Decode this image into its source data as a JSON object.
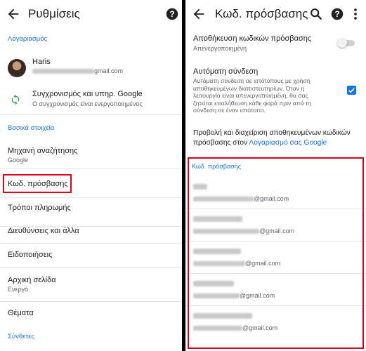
{
  "left": {
    "title": "Ρυθμίσεις",
    "section_account": "Λογαριασμός",
    "account": {
      "name": "Haris",
      "email_domain": "gmail.com"
    },
    "sync": {
      "label": "Συγχρονισμός και υπηρ. Google",
      "status": "Ο συγχρονισμός είναι ενεργοποιημένος"
    },
    "section_basic": "Βασικά στοιχεία",
    "items": [
      {
        "label": "Μηχανή αναζήτησης",
        "value": "Google"
      },
      {
        "label": "Κωδ. πρόσβασης"
      },
      {
        "label": "Τρόποι πληρωμής"
      },
      {
        "label": "Διευθύνσεις και άλλα"
      },
      {
        "label": "Ειδοποιήσεις"
      },
      {
        "label": "Αρχική σελίδα",
        "value": "Ενεργό"
      },
      {
        "label": "Θέματα"
      }
    ],
    "section_advanced": "Σύνθετες"
  },
  "right": {
    "title": "Κωδ. πρόσβασης",
    "save_passwords": {
      "label": "Αποθήκευση κωδικών πρόσβασης",
      "status": "Απενεργοποιημένη",
      "enabled": false
    },
    "auto_signin": {
      "label": "Αυτόματη σύνδεση",
      "description": [
        "Αυτόματη σύνδεση σε ιστότοπους με χρήση",
        "αποθηκευμένων διαπιστευτηρίων. Όταν η",
        "λειτουργία είναι απενεργοποιημένη, θα σας",
        "ζητείται επαλήθευση κάθε φορά πριν από τη",
        "σύνδεση σε έναν ιστότοπο."
      ],
      "checked": true
    },
    "manage": {
      "line1": "Προβολή και διαχείριση αποθηκευμένων κωδικών",
      "line2_prefix": "πρόσβασης στον ",
      "line2_link": "Λογαριασμό σας Google"
    },
    "section_passwords": "Κωδ. πρόσβασης",
    "passwords": [
      {
        "email_domain": "@gmail.com"
      },
      {
        "email_domain": "@gmail.com"
      },
      {
        "email_domain": "@gmail.com"
      },
      {
        "email_domain": "@gmail.com"
      },
      {
        "email_domain": "@gmail.com"
      }
    ]
  },
  "colors": {
    "accent": "#1a73e8",
    "highlight": "#e0001b"
  },
  "icons": [
    "back-arrow-icon",
    "help-icon",
    "sync-icon",
    "search-icon",
    "more-vert-icon"
  ]
}
